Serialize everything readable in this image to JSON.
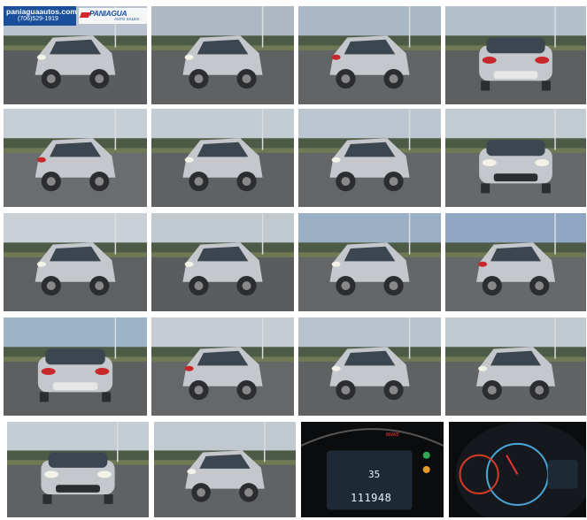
{
  "dealer": {
    "website": "paniaguaautos.com",
    "phone": "(706)529-1919",
    "logo_text": "PANIAGUA",
    "logo_sub": "AUTO SALES"
  },
  "dashboard": {
    "speed": "35",
    "odometer": "111948",
    "brake_label": "BRAKE"
  },
  "photos": [
    {
      "view": "front-left",
      "sky": "#b9c3cf",
      "ground": "#5a5c5f",
      "car": "silver"
    },
    {
      "view": "side-left",
      "sky": "#aeb8c2",
      "ground": "#5f6163",
      "car": "silver"
    },
    {
      "view": "rear-left",
      "sky": "#a9b7c6",
      "ground": "#626466",
      "car": "silver"
    },
    {
      "view": "rear",
      "sky": "#b4c0cc",
      "ground": "#5c5e60",
      "car": "silver"
    },
    {
      "view": "rear-left",
      "sky": "#c6ced6",
      "ground": "#6a6c6e",
      "car": "silver"
    },
    {
      "view": "side-left",
      "sky": "#c3cbd3",
      "ground": "#5f6163",
      "car": "silver"
    },
    {
      "view": "front-right",
      "sky": "#bcc6d0",
      "ground": "#636567",
      "car": "silver"
    },
    {
      "view": "front",
      "sky": "#c2cad2",
      "ground": "#666869",
      "car": "silver"
    },
    {
      "view": "front-right",
      "sky": "#c9d0d7",
      "ground": "#5e6062",
      "car": "silver"
    },
    {
      "view": "front-right",
      "sky": "#c0c8d0",
      "ground": "#5a5c5e",
      "car": "silver"
    },
    {
      "view": "side-left",
      "sky": "#9aaec4",
      "ground": "#646668",
      "car": "silver"
    },
    {
      "view": "rear-right",
      "sky": "#8fa7c2",
      "ground": "#666869",
      "car": "silver"
    },
    {
      "view": "rear",
      "sky": "#9db3c8",
      "ground": "#5d5f61",
      "car": "silver"
    },
    {
      "view": "rear-left",
      "sky": "#c5ccd3",
      "ground": "#656769",
      "car": "silver"
    },
    {
      "view": "side-left",
      "sky": "#b7c2cd",
      "ground": "#5f6163",
      "car": "silver"
    },
    {
      "view": "front-right",
      "sky": "#c1c9d1",
      "ground": "#616365",
      "car": "silver"
    },
    {
      "view": "front",
      "sky": "#c4ccd4",
      "ground": "#5f6163",
      "car": "silver"
    },
    {
      "view": "front-right",
      "sky": "#c0c8d0",
      "ground": "#606264",
      "car": "silver"
    },
    {
      "view": "dash-odometer",
      "sky": "#000000",
      "ground": "#000000",
      "car": "none"
    },
    {
      "view": "dash-cluster",
      "sky": "#000000",
      "ground": "#000000",
      "car": "none"
    }
  ]
}
